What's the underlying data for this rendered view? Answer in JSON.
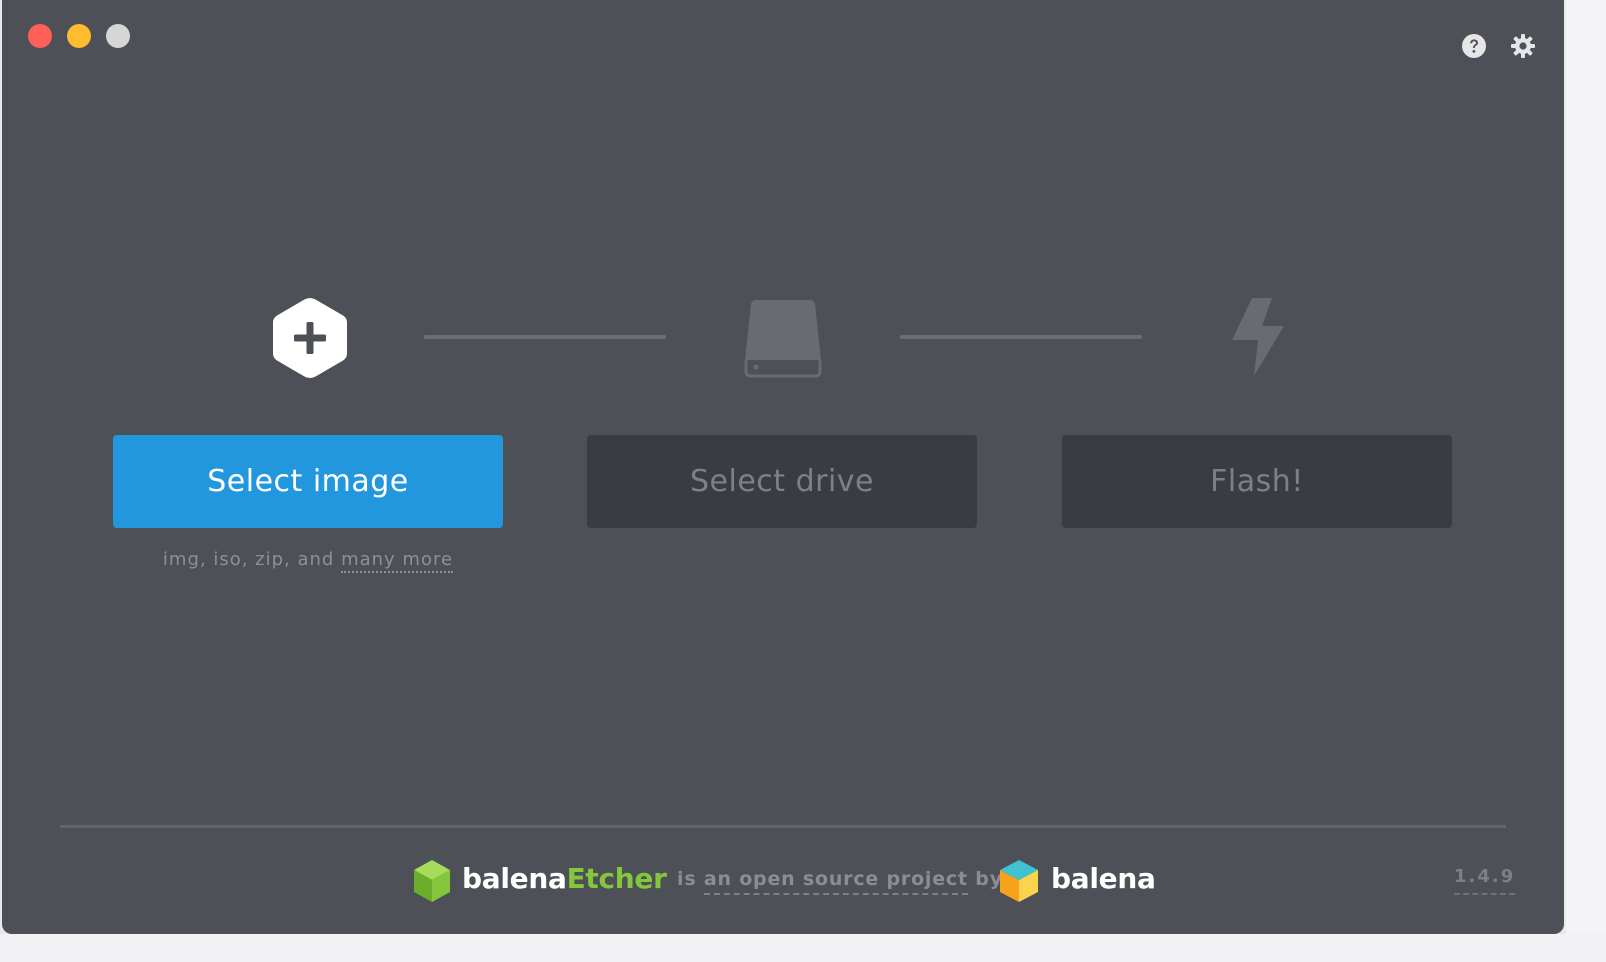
{
  "window": {
    "controls": [
      "close",
      "minimize",
      "maximize"
    ]
  },
  "toolbar": {
    "help_icon": "help-circle-icon",
    "settings_icon": "gear-icon"
  },
  "steps": {
    "image": {
      "icon": "hexagon-plus-icon",
      "button_label": "Select image",
      "active": true
    },
    "drive": {
      "icon": "drive-icon",
      "button_label": "Select drive",
      "active": false
    },
    "flash": {
      "icon": "lightning-bolt-icon",
      "button_label": "Flash!",
      "active": false
    }
  },
  "supported_formats": {
    "text": "img, iso, zip, and ",
    "link_text": "many more"
  },
  "footer": {
    "product_name_part1": "balena",
    "product_name_part2": "Etcher",
    "tagline": "is ",
    "tagline_link": "an open source project",
    "tagline_suffix": " by",
    "company_name": "balena",
    "version": "1.4.9"
  },
  "colors": {
    "window_bg": "#4d5057",
    "primary_button": "#2297de",
    "disabled_button": "#3a3c41",
    "etcher_green": "#85c73b"
  }
}
